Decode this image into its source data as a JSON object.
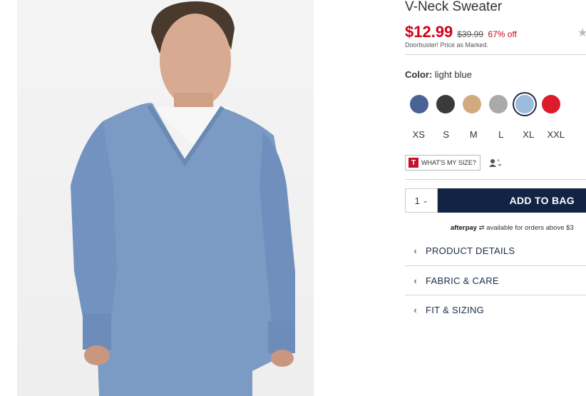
{
  "product": {
    "title": "V-Neck Sweater",
    "price_now": "$12.99",
    "price_was": "$39.99",
    "discount": "67% off",
    "promo": "Doorbuster! Price as Marked."
  },
  "color": {
    "label": "Color:",
    "value": "light blue",
    "swatches": [
      {
        "name": "navy heather",
        "hex": "#4a6396"
      },
      {
        "name": "charcoal",
        "hex": "#3a3a3a"
      },
      {
        "name": "tan",
        "hex": "#d2aa80"
      },
      {
        "name": "light grey",
        "hex": "#aaaaaa"
      },
      {
        "name": "light blue",
        "hex": "#9cbcdc",
        "selected": true
      },
      {
        "name": "red",
        "hex": "#dd1b2a"
      }
    ]
  },
  "sizes": [
    "XS",
    "S",
    "M",
    "L",
    "XL",
    "XXL"
  ],
  "fit": {
    "logo": "T",
    "label": "WHAT'S MY SIZE?"
  },
  "cart": {
    "quantity": "1",
    "add_label": "ADD TO BAG"
  },
  "afterpay": {
    "brand": "afterpay",
    "text": "available for orders above $3"
  },
  "accordions": [
    {
      "label": "PRODUCT DETAILS"
    },
    {
      "label": "FABRIC & CARE"
    },
    {
      "label": "FIT & SIZING"
    }
  ],
  "colors": {
    "sale_red": "#d0021b",
    "navy": "#122344"
  }
}
